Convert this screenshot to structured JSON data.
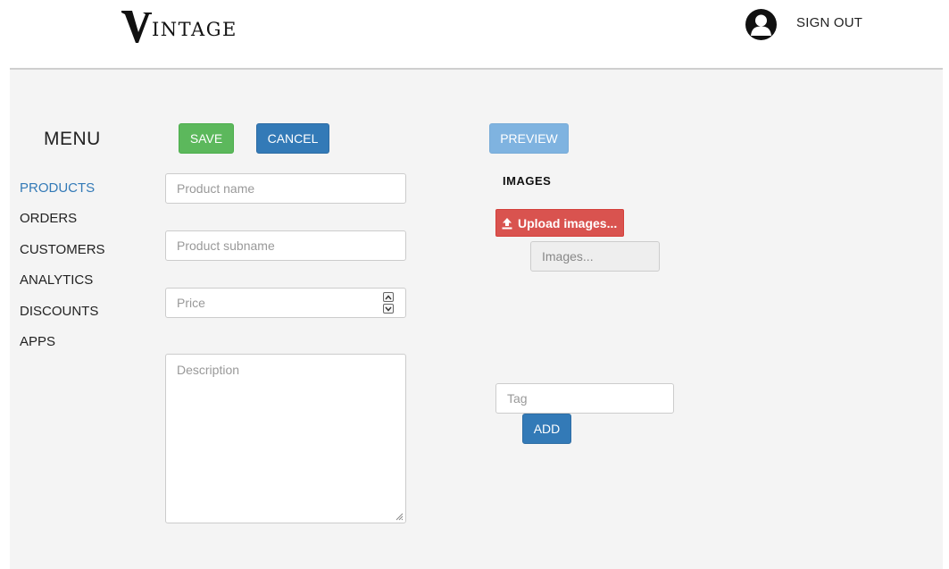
{
  "header": {
    "logo_letter": "V",
    "logo_rest": "INTAGE",
    "signout_label": "SIGN OUT"
  },
  "menu": {
    "title": "MENU",
    "items": [
      {
        "label": "PRODUCTS",
        "active": true
      },
      {
        "label": "ORDERS"
      },
      {
        "label": "CUSTOMERS"
      },
      {
        "label": "ANALYTICS"
      },
      {
        "label": "DISCOUNTS"
      },
      {
        "label": "APPS"
      }
    ]
  },
  "toolbar": {
    "save_label": "SAVE",
    "cancel_label": "CANCEL",
    "preview_label": "PREVIEW"
  },
  "form": {
    "product_name_placeholder": "Product name",
    "product_subname_placeholder": "Product subname",
    "price_placeholder": "Price",
    "description_placeholder": "Description"
  },
  "images": {
    "title": "IMAGES",
    "upload_label": "Upload images...",
    "images_field_placeholder": "Images..."
  },
  "tags": {
    "tag_placeholder": "Tag",
    "add_label": "ADD"
  },
  "colors": {
    "save": "#5cb85c",
    "primary": "#337ab7",
    "preview": "#7fb3e0",
    "upload": "#d9534f",
    "active_nav": "#337ab7"
  },
  "icons": {
    "avatar": "user-avatar-icon",
    "upload": "upload-icon",
    "spinner_up": "chevron-up-icon",
    "spinner_down": "chevron-down-icon"
  }
}
